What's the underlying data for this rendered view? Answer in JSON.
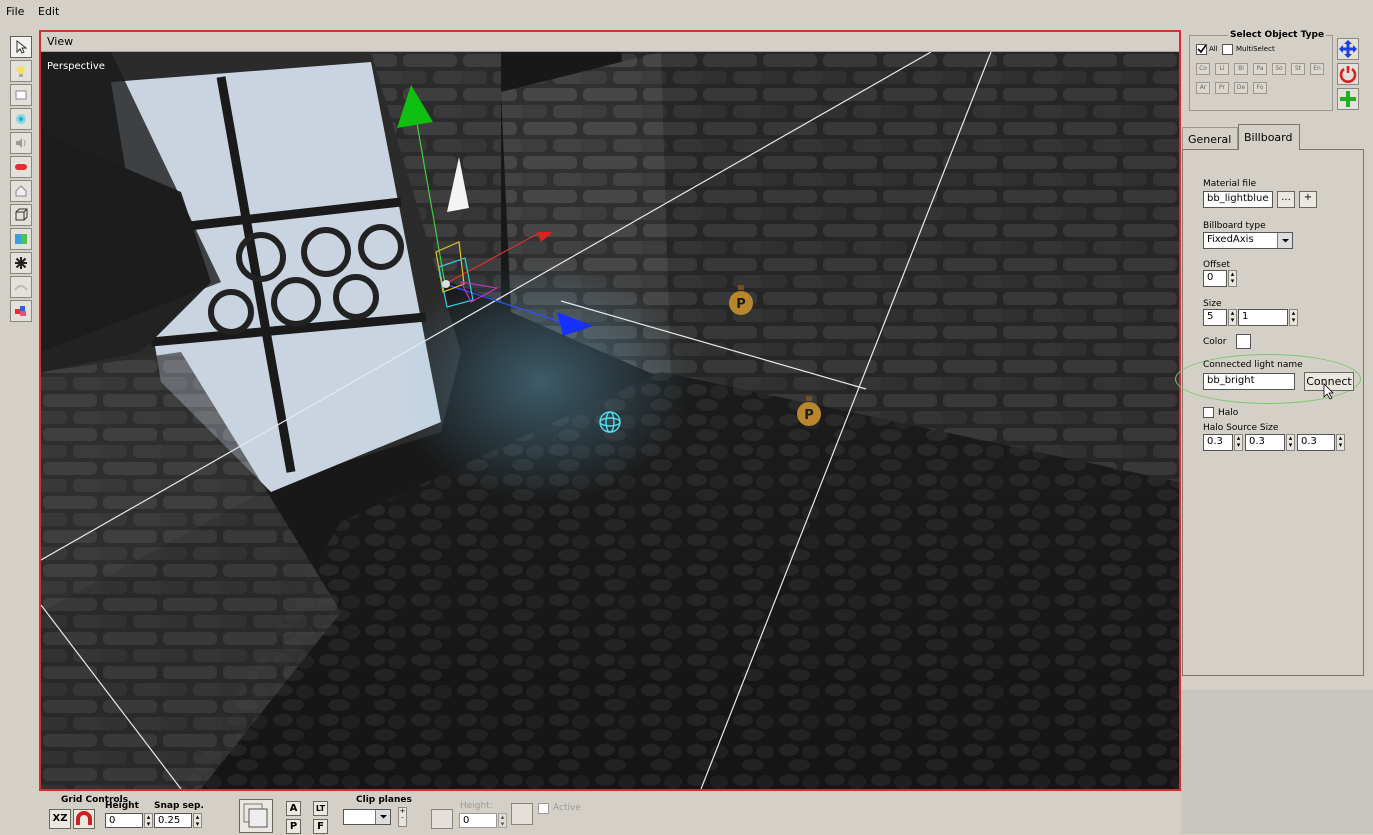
{
  "menu": {
    "file": "File",
    "edit": "Edit"
  },
  "toolbar": {
    "buttons": [
      "select-cursor-icon",
      "light-bulb-icon",
      "window-icon",
      "particle-icon",
      "sound-icon",
      "capsule-icon",
      "house-icon",
      "cube-wireframe-icon",
      "gradient-icon",
      "star-icon",
      "sky-icon",
      "color-blocks-icon"
    ]
  },
  "viewport": {
    "title": "View",
    "mode_label": "Perspective",
    "marker_label": "P"
  },
  "select_object_type": {
    "title": "Select Object Type",
    "all_label": "All",
    "all_checked": true,
    "multiselect_label": "MultiSelect",
    "multiselect_checked": false,
    "type_buttons_row1": [
      "Co",
      "Li",
      "Bi",
      "Pa",
      "So",
      "St",
      "En"
    ],
    "type_buttons_row2": [
      "Ar",
      "Pr",
      "De",
      "Fo"
    ]
  },
  "transform_tools": [
    "move-arrows-icon",
    "rotate-icon",
    "scale-icon"
  ],
  "tabs": {
    "general": "General",
    "billboard": "Billboard",
    "active": "Billboard"
  },
  "billboard": {
    "material_file_label": "Material file",
    "material_file_value": "bb_lightblue",
    "browse_label": "...",
    "add_label": "+",
    "billboard_type_label": "Billboard type",
    "billboard_type_value": "FixedAxis",
    "offset_label": "Offset",
    "offset_value": "0",
    "size_label": "Size",
    "size_x": "5",
    "size_y": "1",
    "color_label": "Color",
    "color_value": "#ffffff",
    "connected_light_label": "Connected light name",
    "connected_light_value": "bb_bright",
    "connect_label": "Connect",
    "halo_label": "Halo",
    "halo_checked": false,
    "halo_source_label": "Halo Source Size",
    "halo_x": "0.3",
    "halo_y": "0.3",
    "halo_z": "0.3"
  },
  "grid_controls": {
    "title": "Grid Controls",
    "xz_label": "XZ",
    "height_label": "Height",
    "height_value": "0",
    "snap_label": "Snap sep.",
    "snap_value": "0.25"
  },
  "view_buttons": {
    "a": "A",
    "lt": "LT",
    "p": "P",
    "f": "F"
  },
  "clip_planes": {
    "title": "Clip planes",
    "height_label": "Height:",
    "height_value": "0",
    "active_label": "Active"
  },
  "colors": {
    "viewport_border": "#d03028",
    "selection_ellipse": "#7bc86c"
  }
}
